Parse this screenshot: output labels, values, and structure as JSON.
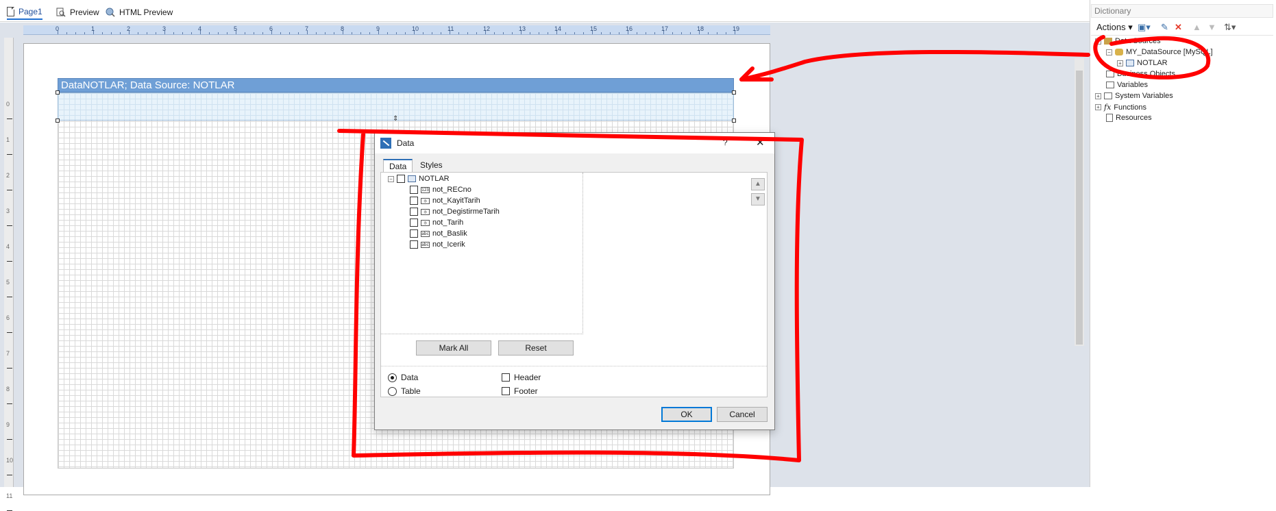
{
  "tabs": [
    {
      "label": "Page1",
      "icon": "page-icon",
      "active": true
    },
    {
      "label": "Preview",
      "icon": "preview-icon"
    },
    {
      "label": "HTML Preview",
      "icon": "html-preview-icon"
    }
  ],
  "ruler": {
    "h": [
      "0",
      "1",
      "2",
      "3",
      "4",
      "5",
      "6",
      "7",
      "8",
      "9",
      "10",
      "11",
      "12",
      "13",
      "14",
      "15",
      "16",
      "17",
      "18",
      "19"
    ],
    "v": [
      "0",
      "1",
      "2",
      "3",
      "4",
      "5",
      "6",
      "7",
      "8",
      "9",
      "10",
      "11"
    ]
  },
  "band": {
    "title": "DataNOTLAR; Data Source: NOTLAR"
  },
  "dictionary": {
    "title": "Dictionary",
    "actions_label": "Actions",
    "tree": {
      "data_sources": "Data Sources",
      "datasource": "MY_DataSource [MySQL]",
      "table": "NOTLAR",
      "business_objects": "Business Objects",
      "variables": "Variables",
      "system_variables": "System Variables",
      "functions": "Functions",
      "resources": "Resources"
    }
  },
  "dialog": {
    "title": "Data",
    "help": "?",
    "tabs": [
      "Data",
      "Styles"
    ],
    "root": "NOTLAR",
    "fields": [
      {
        "name": "not_RECno",
        "type": "123"
      },
      {
        "name": "not_KayitTarih",
        "type": "clock"
      },
      {
        "name": "not_DegistirmeTarih",
        "type": "clock"
      },
      {
        "name": "not_Tarih",
        "type": "clock"
      },
      {
        "name": "not_Baslik",
        "type": "abc"
      },
      {
        "name": "not_Icerik",
        "type": "abc"
      }
    ],
    "mark_all": "Mark All",
    "reset": "Reset",
    "options": {
      "data": "Data",
      "table": "Table",
      "header": "Header",
      "footer": "Footer"
    },
    "selected_mode": "Data",
    "ok": "OK",
    "cancel": "Cancel"
  },
  "colors": {
    "annotation": "#ff0000",
    "band": "#6f9fd6",
    "accent": "#2e6fb6"
  }
}
